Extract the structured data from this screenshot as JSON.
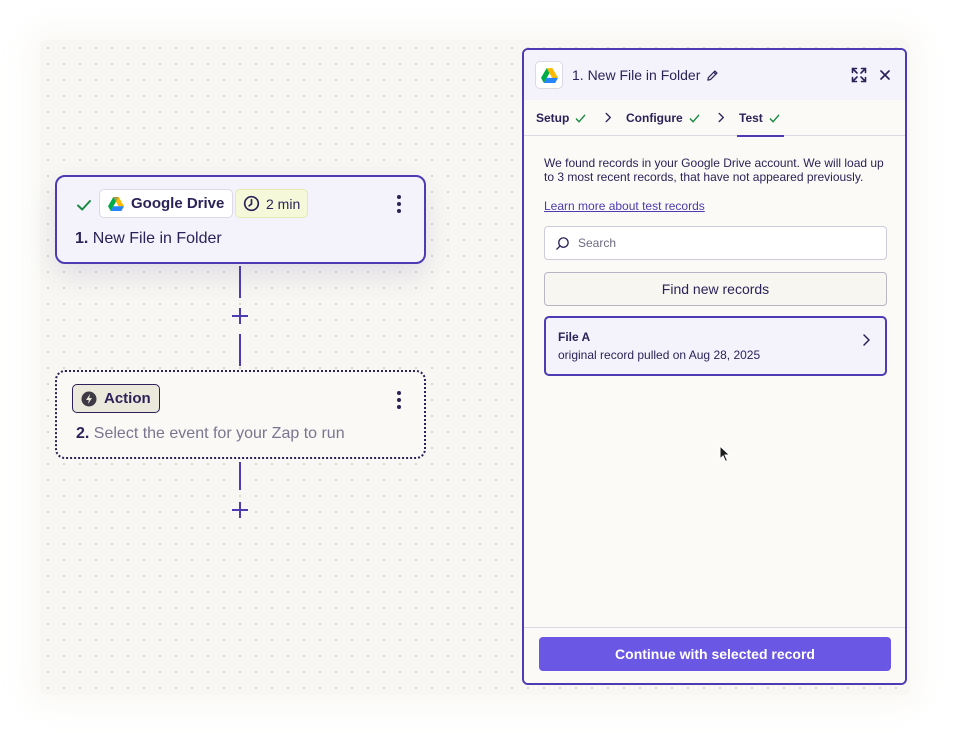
{
  "trigger_step": {
    "app_name": "Google Drive",
    "duration": "2 min",
    "number": "1.",
    "title": "New File in Folder"
  },
  "action_step": {
    "chip_label": "Action",
    "number": "2.",
    "description": "Select the event for your Zap to run"
  },
  "panel": {
    "title": "1. New File in Folder",
    "tabs": [
      {
        "label": "Setup"
      },
      {
        "label": "Configure"
      },
      {
        "label": "Test"
      }
    ],
    "active_tab": "Test",
    "info_text": "We found records in your Google Drive account. We will load up to 3 most recent records, that have not appeared previously.",
    "learn_link": "Learn more about test records",
    "search_placeholder": "Search",
    "find_button": "Find new records",
    "records": [
      {
        "title": "File A",
        "subtitle": "original record pulled on Aug 28, 2025"
      }
    ],
    "continue_button": "Continue with selected record"
  },
  "colors": {
    "accent": "#4d3bb3",
    "primary_button": "#6a57e3",
    "success": "#1a8a43"
  },
  "icons": [
    "check-icon",
    "google-drive-icon",
    "clock-icon",
    "kebab-menu-icon",
    "plus-icon",
    "bolt-icon",
    "pencil-icon",
    "expand-icon",
    "close-icon",
    "chevron-right-icon",
    "search-icon",
    "cursor-icon"
  ]
}
